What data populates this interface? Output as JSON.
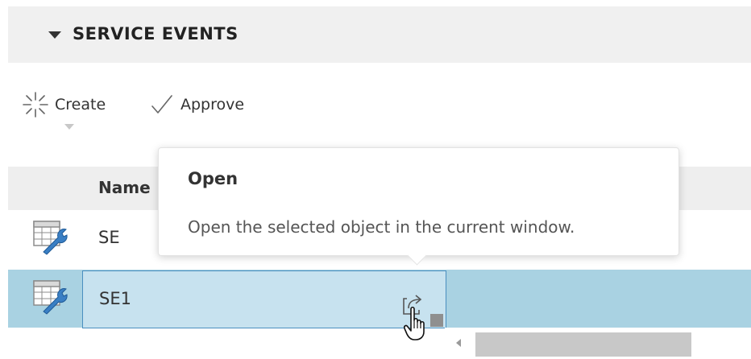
{
  "section": {
    "title": "SERVICE EVENTS"
  },
  "toolbar": {
    "create_label": "Create",
    "approve_label": "Approve",
    "create_icon": "sparkle-icon",
    "approve_icon": "check-icon"
  },
  "grid": {
    "columns": [
      {
        "label": "Name"
      }
    ],
    "rows": [
      {
        "name": "SE",
        "icon": "table-wrench-icon",
        "selected": false
      },
      {
        "name": "SE1",
        "icon": "table-wrench-icon",
        "selected": true
      }
    ]
  },
  "tooltip": {
    "title": "Open",
    "description": "Open the selected object in the current window."
  },
  "colors": {
    "selected_row": "#a9d2e2",
    "selected_cell": "#c7e2ef",
    "selected_border": "#4a8fbf",
    "header_bg": "#f0f0f0"
  }
}
